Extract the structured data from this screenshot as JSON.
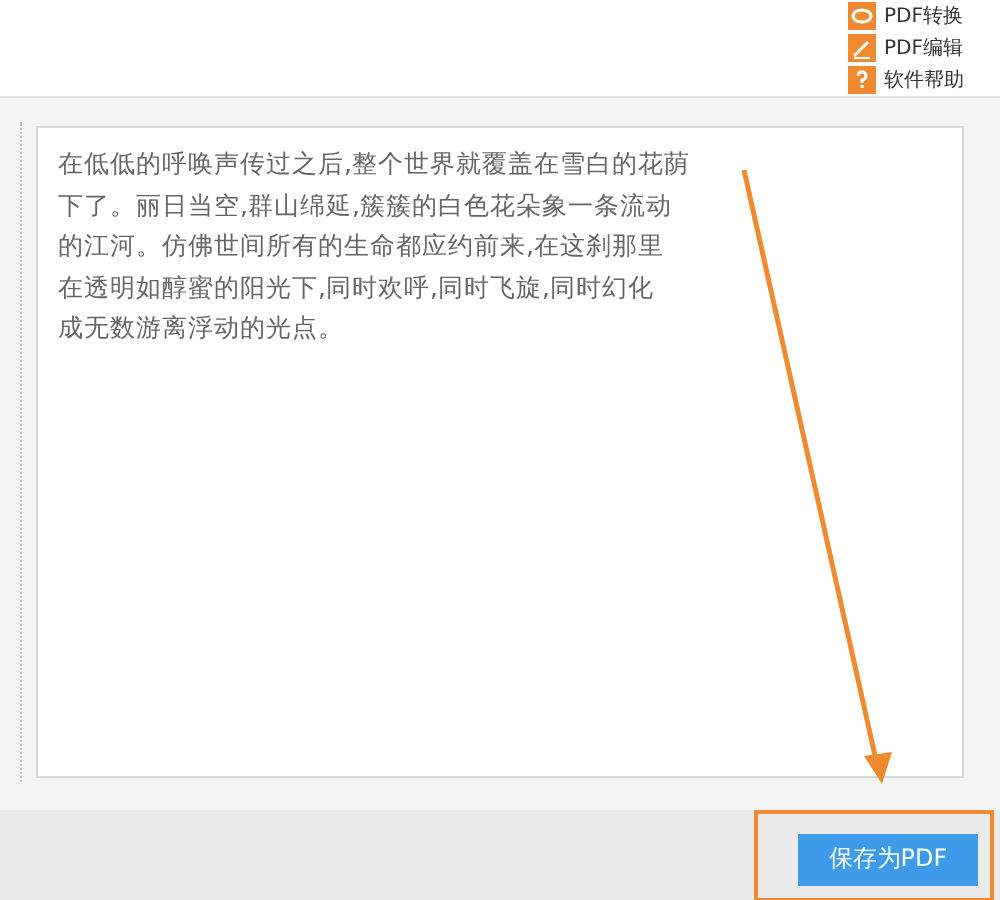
{
  "toolbar": {
    "buttons": [
      {
        "kind": "convert",
        "label": "PDF转换"
      },
      {
        "kind": "edit",
        "label": "PDF编辑"
      },
      {
        "kind": "help",
        "label": "软件帮助"
      }
    ]
  },
  "editor": {
    "lines": [
      "在低低的呼唤声传过之后,整个世界就覆盖在雪白的花荫",
      "下了。丽日当空,群山绵延,簇簇的白色花朵象一条流动",
      "的江河。仿佛世间所有的生命都应约前来,在这刹那里",
      "在透明如醇蜜的阳光下,同时欢呼,同时飞旋,同时幻化",
      "成无数游离浮动的光点。"
    ]
  },
  "footer": {
    "button": "保存为PDF",
    "highlighted": true
  }
}
